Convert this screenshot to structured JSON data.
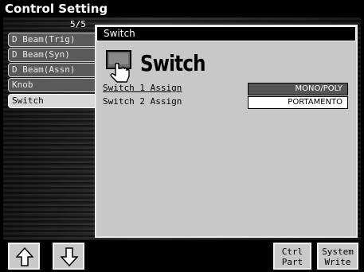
{
  "window": {
    "title": "Control Setting"
  },
  "page_indicator": "5/5",
  "tabs": [
    {
      "label": "D Beam(Trig)",
      "selected": false
    },
    {
      "label": "D Beam(Syn)",
      "selected": false
    },
    {
      "label": "D Beam(Assn)",
      "selected": false
    },
    {
      "label": "Knob",
      "selected": false
    },
    {
      "label": "Switch",
      "selected": true
    }
  ],
  "panel": {
    "title": "Switch",
    "heading": "Switch",
    "icon": "switch-hand-icon",
    "params": [
      {
        "label": "Switch 1 Assign",
        "value": "MONO/POLY",
        "selected": true
      },
      {
        "label": "Switch 2 Assign",
        "value": "PORTAMENTO",
        "selected": false
      }
    ]
  },
  "bottom": {
    "up_icon": "arrow-up-icon",
    "down_icon": "arrow-down-icon",
    "ctrl_part_label": "Ctrl\nPart",
    "system_write_label": "System\nWrite"
  }
}
